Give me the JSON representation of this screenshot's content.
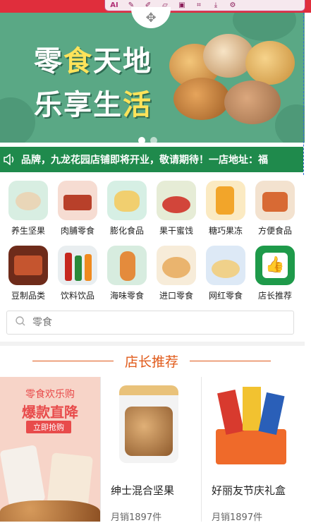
{
  "banner": {
    "line1_a": "零",
    "line1_hl": "食",
    "line1_b": "天地",
    "line2_a": "乐享生",
    "line2_hl": "活"
  },
  "notice": {
    "text": "品牌，九龙花园店铺即将开业，敬请期待！一店地址：福"
  },
  "categories": [
    {
      "label": "养生坚果"
    },
    {
      "label": "肉脯零食"
    },
    {
      "label": "膨化食品"
    },
    {
      "label": "果干蜜饯"
    },
    {
      "label": "糖巧果冻"
    },
    {
      "label": "方便食品"
    },
    {
      "label": "豆制品类"
    },
    {
      "label": "饮料饮品"
    },
    {
      "label": "海味零食"
    },
    {
      "label": "进口零食"
    },
    {
      "label": "网红零食"
    },
    {
      "label": "店长推荐"
    }
  ],
  "search": {
    "placeholder": "零食"
  },
  "section": {
    "title": "店长推荐"
  },
  "promo": {
    "line1": "零食欢乐购",
    "line2": "爆款直降",
    "button": "立即抢购"
  },
  "products": [
    {
      "name": "绅士混合坚果",
      "sales": "月销1897件"
    },
    {
      "name": "好丽友节庆礼盒",
      "sales": "月销1897件"
    }
  ],
  "colors": {
    "accent": "#e05a1a",
    "banner": "#5aa885",
    "notice": "#1f8a4c",
    "promo_red": "#e84b4b"
  }
}
